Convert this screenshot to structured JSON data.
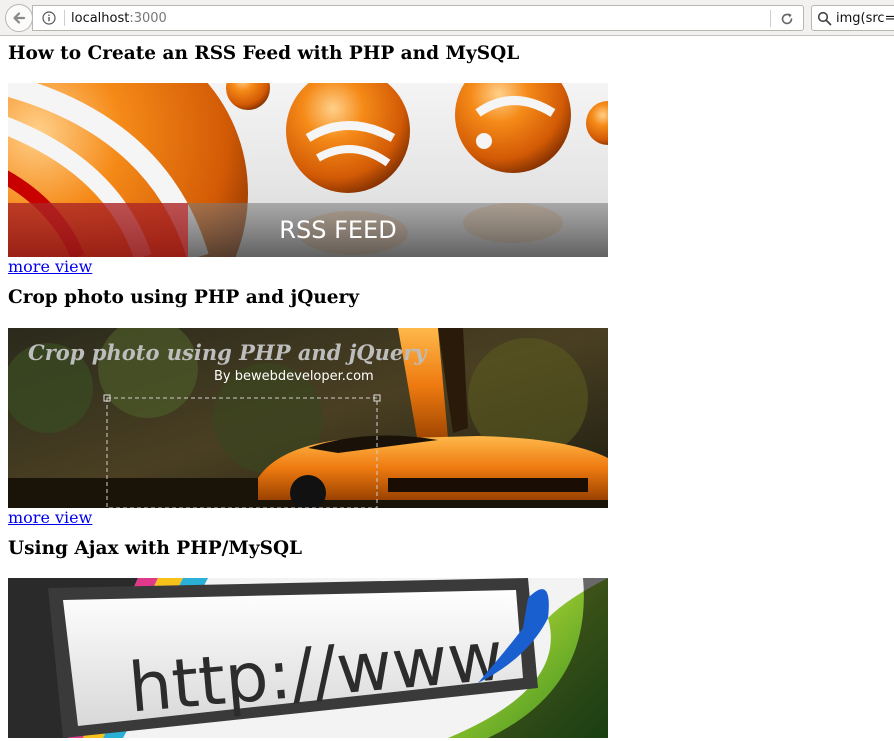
{
  "browser": {
    "url_host": "localhost",
    "url_port": ":3000",
    "search_text": "img(src="
  },
  "articles": [
    {
      "title": "How to Create an RSS Feed with PHP and MySQL",
      "image_caption": "RSS FEED",
      "link_label": "more view"
    },
    {
      "title": "Crop photo using PHP and jQuery",
      "image_caption": "Crop photo using PHP and jQuery",
      "image_byline": "By  bewebdeveloper.com",
      "link_label": "more view"
    },
    {
      "title": "Using Ajax with PHP/MySQL",
      "image_caption": "http://www",
      "link_label": ""
    }
  ],
  "colors": {
    "link": "#0000ee",
    "rss_orange": "#f07a10"
  }
}
